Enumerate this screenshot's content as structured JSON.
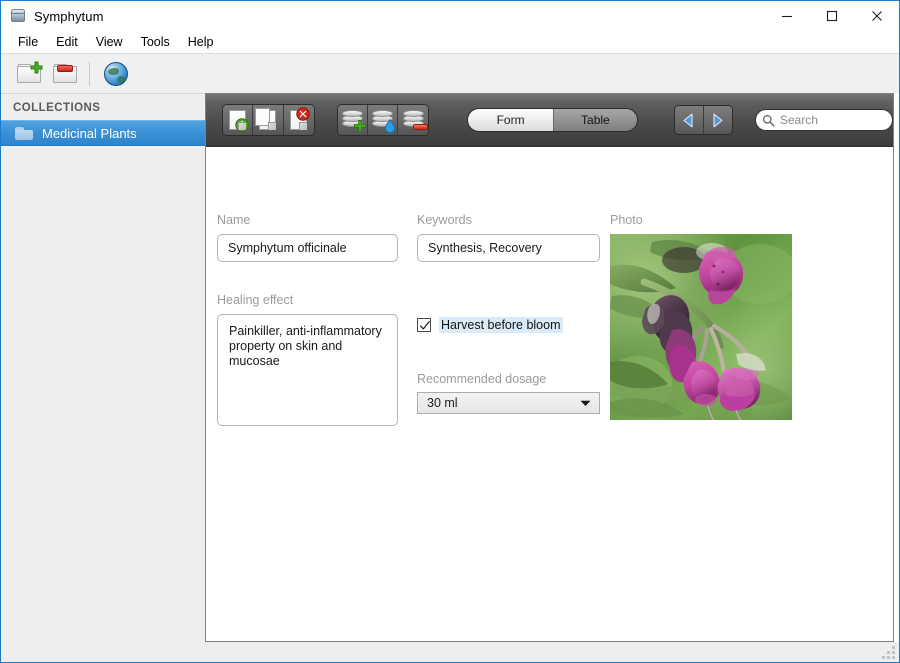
{
  "window": {
    "title": "Symphytum",
    "app_icon": "symphytum-can-icon",
    "minimize_label": "—",
    "maximize_label": "□",
    "close_label": "✕",
    "accent_border": "#1a7ccc"
  },
  "menubar": {
    "items": [
      {
        "label": "File"
      },
      {
        "label": "Edit"
      },
      {
        "label": "View"
      },
      {
        "label": "Tools"
      },
      {
        "label": "Help"
      }
    ]
  },
  "apptoolbar": {
    "buttons": [
      {
        "name": "add-collection-button",
        "icon": "folder-plus-icon",
        "label": "Add collection"
      },
      {
        "name": "delete-collection-button",
        "icon": "folder-minus-icon",
        "label": "Delete collection"
      },
      {
        "name": "cloud-sync-button",
        "icon": "globe-icon",
        "label": "Cloud sync"
      }
    ]
  },
  "sidebar": {
    "header": "COLLECTIONS",
    "selected_index": 0,
    "selected_color": "#3a90d4",
    "items": [
      {
        "label": "Medicinal Plants",
        "icon": "folder-icon"
      }
    ]
  },
  "inner_toolbar": {
    "record_group": [
      {
        "name": "add-record-button",
        "icon": "page-plus-icon",
        "label": "Add record"
      },
      {
        "name": "duplicate-record-button",
        "icon": "page-copy-icon",
        "label": "Duplicate record"
      },
      {
        "name": "delete-record-button",
        "icon": "page-delete-icon",
        "label": "Delete record"
      }
    ],
    "field_group": [
      {
        "name": "add-field-button",
        "icon": "database-plus-icon",
        "label": "Add field"
      },
      {
        "name": "modify-field-button",
        "icon": "database-edit-icon",
        "label": "Modify field"
      },
      {
        "name": "delete-field-button",
        "icon": "database-delete-icon",
        "label": "Delete field"
      }
    ],
    "view_toggle": {
      "options": [
        "Form",
        "Table"
      ],
      "selected": "Form"
    },
    "navigation": [
      {
        "name": "previous-record-button",
        "icon": "arrow-left-icon",
        "label": "Previous record"
      },
      {
        "name": "next-record-button",
        "icon": "arrow-right-icon",
        "label": "Next record"
      }
    ],
    "search": {
      "placeholder": "Search",
      "value": "",
      "icon": "search-icon"
    }
  },
  "form": {
    "fields": [
      {
        "name": "name-field",
        "label": "Name",
        "type": "text",
        "value": "Symphytum officinale"
      },
      {
        "name": "keywords-field",
        "label": "Keywords",
        "type": "text",
        "value": "Synthesis, Recovery"
      },
      {
        "name": "healing-effect-field",
        "label": "Healing effect",
        "type": "textarea",
        "value": "Painkiller, anti-inflammatory\nproperty on skin and mucosae"
      },
      {
        "name": "harvest-before-bloom-field",
        "label": "Harvest before bloom",
        "type": "checkbox",
        "checked": true
      },
      {
        "name": "recommended-dosage-field",
        "label": "Recommended dosage",
        "type": "combobox",
        "value": "30 ml"
      },
      {
        "name": "photo-field",
        "label": "Photo",
        "type": "image",
        "value": "comfrey-flower-photo"
      }
    ]
  },
  "status": {
    "resize_grip": "resize-grip"
  }
}
